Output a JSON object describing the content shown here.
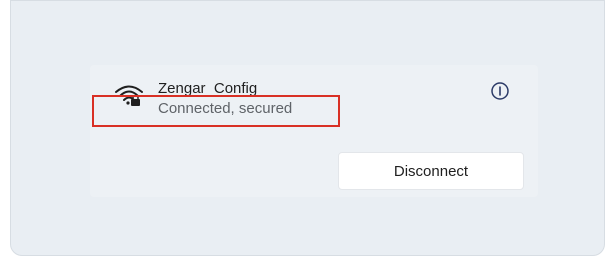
{
  "network": {
    "ssid": "Zengar_Config",
    "status": "Connected, secured",
    "icon": "wifi-secured-icon"
  },
  "actions": {
    "disconnect_label": "Disconnect",
    "info_icon": "info-icon"
  },
  "colors": {
    "highlight": "#d93025",
    "panel_background": "#e9eef3",
    "button_background": "#ffffff"
  }
}
